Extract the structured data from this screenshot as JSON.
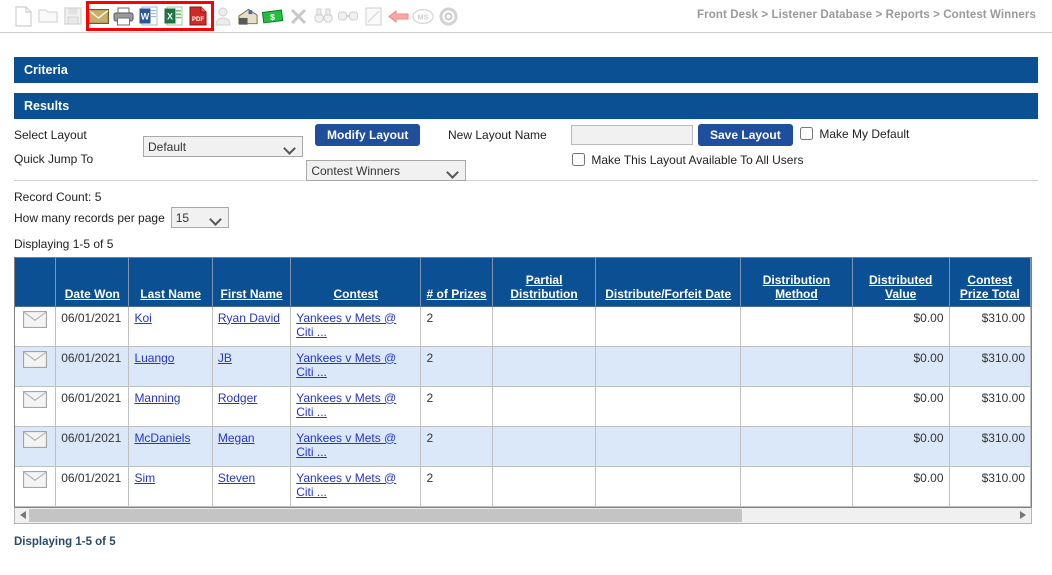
{
  "toolbar": {
    "icons": [
      {
        "name": "new-document-icon",
        "label": "New",
        "enabled": false
      },
      {
        "name": "folder-icon",
        "label": "Open",
        "enabled": false
      },
      {
        "name": "save-disk-icon",
        "label": "Save",
        "enabled": false
      },
      {
        "name": "email-icon",
        "label": "Email",
        "enabled": true
      },
      {
        "name": "print-icon",
        "label": "Print",
        "enabled": true
      },
      {
        "name": "word-export-icon",
        "label": "Export to Word",
        "enabled": true
      },
      {
        "name": "excel-export-icon",
        "label": "Export to Excel",
        "enabled": true
      },
      {
        "name": "pdf-export-icon",
        "label": "Export to PDF",
        "enabled": true
      },
      {
        "name": "contact-icon",
        "label": "Contact",
        "enabled": false
      },
      {
        "name": "mailbox-icon",
        "label": "Mailbox",
        "enabled": true
      },
      {
        "name": "money-icon",
        "label": "Money",
        "enabled": true
      },
      {
        "name": "delete-x-icon",
        "label": "Delete",
        "enabled": false
      },
      {
        "name": "binoculars-icon",
        "label": "Search",
        "enabled": false
      },
      {
        "name": "link-icon",
        "label": "Link",
        "enabled": false
      },
      {
        "name": "notepad-icon",
        "label": "Notes",
        "enabled": false
      },
      {
        "name": "back-arrow-icon",
        "label": "Back",
        "enabled": true
      },
      {
        "name": "logo-icon",
        "label": "Logo",
        "enabled": false
      },
      {
        "name": "gear-icon",
        "label": "Settings",
        "enabled": false
      }
    ],
    "highlight_color": "#ff0000"
  },
  "breadcrumb": {
    "text": "Front Desk > Listener Database > Reports > Contest Winners"
  },
  "sections": {
    "criteria_label": "Criteria",
    "results_label": "Results",
    "bar_color": "#0a5092"
  },
  "layout_controls": {
    "select_layout_label": "Select Layout",
    "select_layout_value": "Default",
    "quick_jump_label": "Quick Jump To",
    "quick_jump_value": "Contest Winners",
    "modify_layout_button": "Modify Layout",
    "new_layout_name_label": "New Layout Name",
    "new_layout_name_value": "",
    "save_layout_button": "Save Layout",
    "make_my_default_label": "Make My Default",
    "make_my_default_checked": false,
    "make_available_all_label": "Make This Layout Available To All Users",
    "make_available_all_checked": false,
    "button_color": "#1f4e9c"
  },
  "records": {
    "record_count_label": "Record Count: 5",
    "per_page_label": "How many records per page",
    "per_page_value": "15",
    "displaying_top": "Displaying 1-5 of 5",
    "displaying_bottom": "Displaying 1-5 of 5"
  },
  "table": {
    "columns": [
      "",
      "Date Won",
      "Last Name",
      "First Name",
      "Contest",
      "# of Prizes",
      "Partial Distribution",
      "Distribute/Forfeit Date",
      "Distribution Method",
      "Distributed Value",
      "Contest Prize Total"
    ],
    "rows": [
      {
        "icon": "envelope-icon",
        "date_won": "06/01/2021",
        "last_name": "Koi",
        "first_name": "Ryan David",
        "contest": "Yankees v Mets @ Citi ...",
        "num_prizes": "2",
        "partial_distribution": "",
        "distribute_forfeit_date": "",
        "distribution_method": "",
        "distributed_value": "$0.00",
        "contest_prize_total": "$310.00"
      },
      {
        "icon": "envelope-icon",
        "date_won": "06/01/2021",
        "last_name": "Luango",
        "first_name": "JB",
        "contest": "Yankees v Mets @ Citi ...",
        "num_prizes": "2",
        "partial_distribution": "",
        "distribute_forfeit_date": "",
        "distribution_method": "",
        "distributed_value": "$0.00",
        "contest_prize_total": "$310.00"
      },
      {
        "icon": "envelope-icon",
        "date_won": "06/01/2021",
        "last_name": "Manning",
        "first_name": "Rodger",
        "contest": "Yankees v Mets @ Citi ...",
        "num_prizes": "2",
        "partial_distribution": "",
        "distribute_forfeit_date": "",
        "distribution_method": "",
        "distributed_value": "$0.00",
        "contest_prize_total": "$310.00"
      },
      {
        "icon": "envelope-icon",
        "date_won": "06/01/2021",
        "last_name": "McDaniels",
        "first_name": "Megan",
        "contest": "Yankees v Mets @ Citi ...",
        "num_prizes": "2",
        "partial_distribution": "",
        "distribute_forfeit_date": "",
        "distribution_method": "",
        "distributed_value": "$0.00",
        "contest_prize_total": "$310.00"
      },
      {
        "icon": "envelope-icon",
        "date_won": "06/01/2021",
        "last_name": "Sim",
        "first_name": "Steven",
        "contest": "Yankees v Mets @ Citi ...",
        "num_prizes": "2",
        "partial_distribution": "",
        "distribute_forfeit_date": "",
        "distribution_method": "",
        "distributed_value": "$0.00",
        "contest_prize_total": "$310.00"
      }
    ],
    "header_color": "#0a5092",
    "alt_row_color": "#dbe8fa",
    "link_color": "#2437c8"
  }
}
